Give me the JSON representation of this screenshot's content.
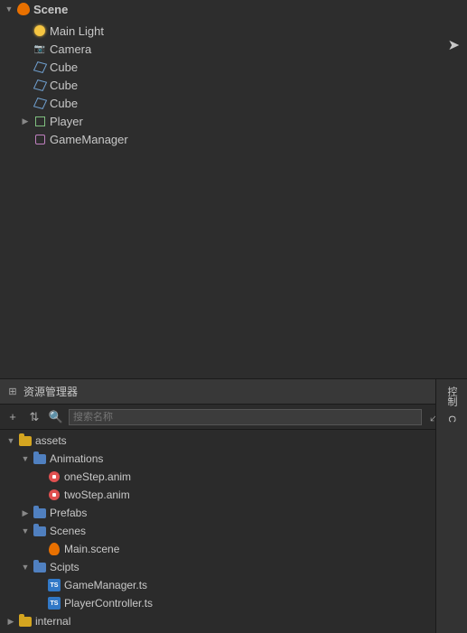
{
  "scene": {
    "root_label": "Scene",
    "children": [
      {
        "name": "Main Light",
        "indent": 1,
        "type": "light",
        "has_toggle": false
      },
      {
        "name": "Camera",
        "indent": 1,
        "type": "camera",
        "has_toggle": false
      },
      {
        "name": "Cube",
        "indent": 1,
        "type": "cube",
        "has_toggle": false
      },
      {
        "name": "Cube",
        "indent": 1,
        "type": "cube",
        "has_toggle": false
      },
      {
        "name": "Cube",
        "indent": 1,
        "type": "cube",
        "has_toggle": false
      },
      {
        "name": "Player",
        "indent": 1,
        "type": "player",
        "has_toggle": true
      },
      {
        "name": "GameManager",
        "indent": 1,
        "type": "gm",
        "has_toggle": false
      }
    ]
  },
  "assets": {
    "panel_title": "资源管理器",
    "search_placeholder": "搜索名称",
    "toolbar": {
      "add_label": "+",
      "sort_label": "⇅",
      "search_label": "🔍",
      "expand_label": "⤢",
      "refresh_label": "↻"
    },
    "tree": [
      {
        "name": "assets",
        "indent": 0,
        "type": "folder_yellow",
        "expanded": true,
        "toggle": "▼"
      },
      {
        "name": "Animations",
        "indent": 1,
        "type": "folder_blue",
        "expanded": true,
        "toggle": "▼"
      },
      {
        "name": "oneStep.anim",
        "indent": 2,
        "type": "anim",
        "expanded": false,
        "toggle": ""
      },
      {
        "name": "twoStep.anim",
        "indent": 2,
        "type": "anim",
        "expanded": false,
        "toggle": ""
      },
      {
        "name": "Prefabs",
        "indent": 1,
        "type": "folder_blue",
        "expanded": false,
        "toggle": "▶"
      },
      {
        "name": "Scenes",
        "indent": 1,
        "type": "folder_blue",
        "expanded": true,
        "toggle": "▼"
      },
      {
        "name": "Main.scene",
        "indent": 2,
        "type": "scene",
        "expanded": false,
        "toggle": ""
      },
      {
        "name": "Scipts",
        "indent": 1,
        "type": "folder_blue",
        "expanded": true,
        "toggle": "▼"
      },
      {
        "name": "GameManager.ts",
        "indent": 2,
        "type": "ts",
        "expanded": false,
        "toggle": ""
      },
      {
        "name": "PlayerController.ts",
        "indent": 2,
        "type": "ts",
        "expanded": false,
        "toggle": ""
      },
      {
        "name": "internal",
        "indent": 0,
        "type": "folder_yellow",
        "expanded": false,
        "toggle": "▶"
      }
    ]
  },
  "right_panel": {
    "tab1": "控制",
    "tab2": "C"
  }
}
